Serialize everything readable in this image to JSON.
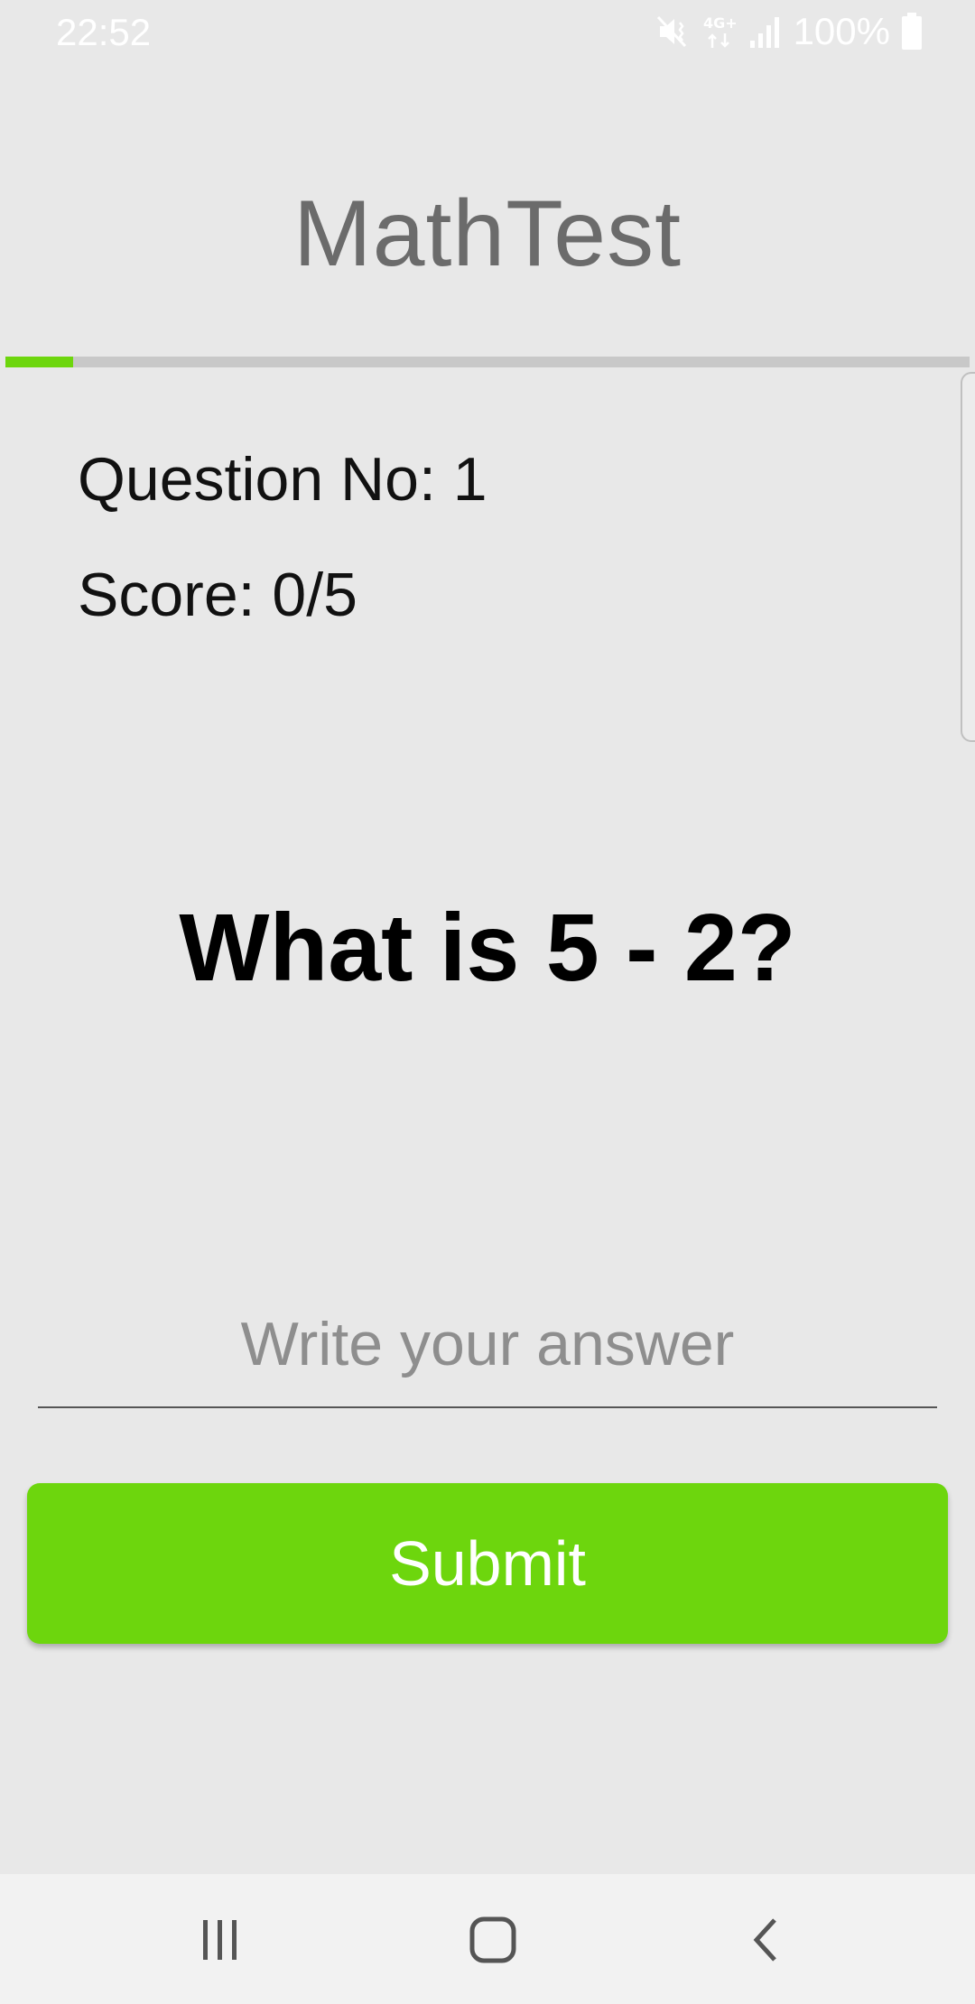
{
  "status_bar": {
    "time": "22:52",
    "battery_text": "100%",
    "icons": [
      "mute-vibrate-icon",
      "4g-plus-icon",
      "signal-icon",
      "battery-icon"
    ]
  },
  "app": {
    "title": "MathTest",
    "progress_fraction": 0.07
  },
  "quiz": {
    "question_no": "Question No: 1",
    "score": "Score: 0/5",
    "question": "What is 5 - 2?",
    "answer_placeholder": "Write your answer",
    "answer_value": "",
    "submit_label": "Submit"
  },
  "colors": {
    "accent": "#6dd60d",
    "background": "#e8e8e8",
    "title": "#6b6b6b"
  },
  "nav_bar": {
    "icons": [
      "recent-apps-icon",
      "home-icon",
      "back-icon"
    ]
  }
}
